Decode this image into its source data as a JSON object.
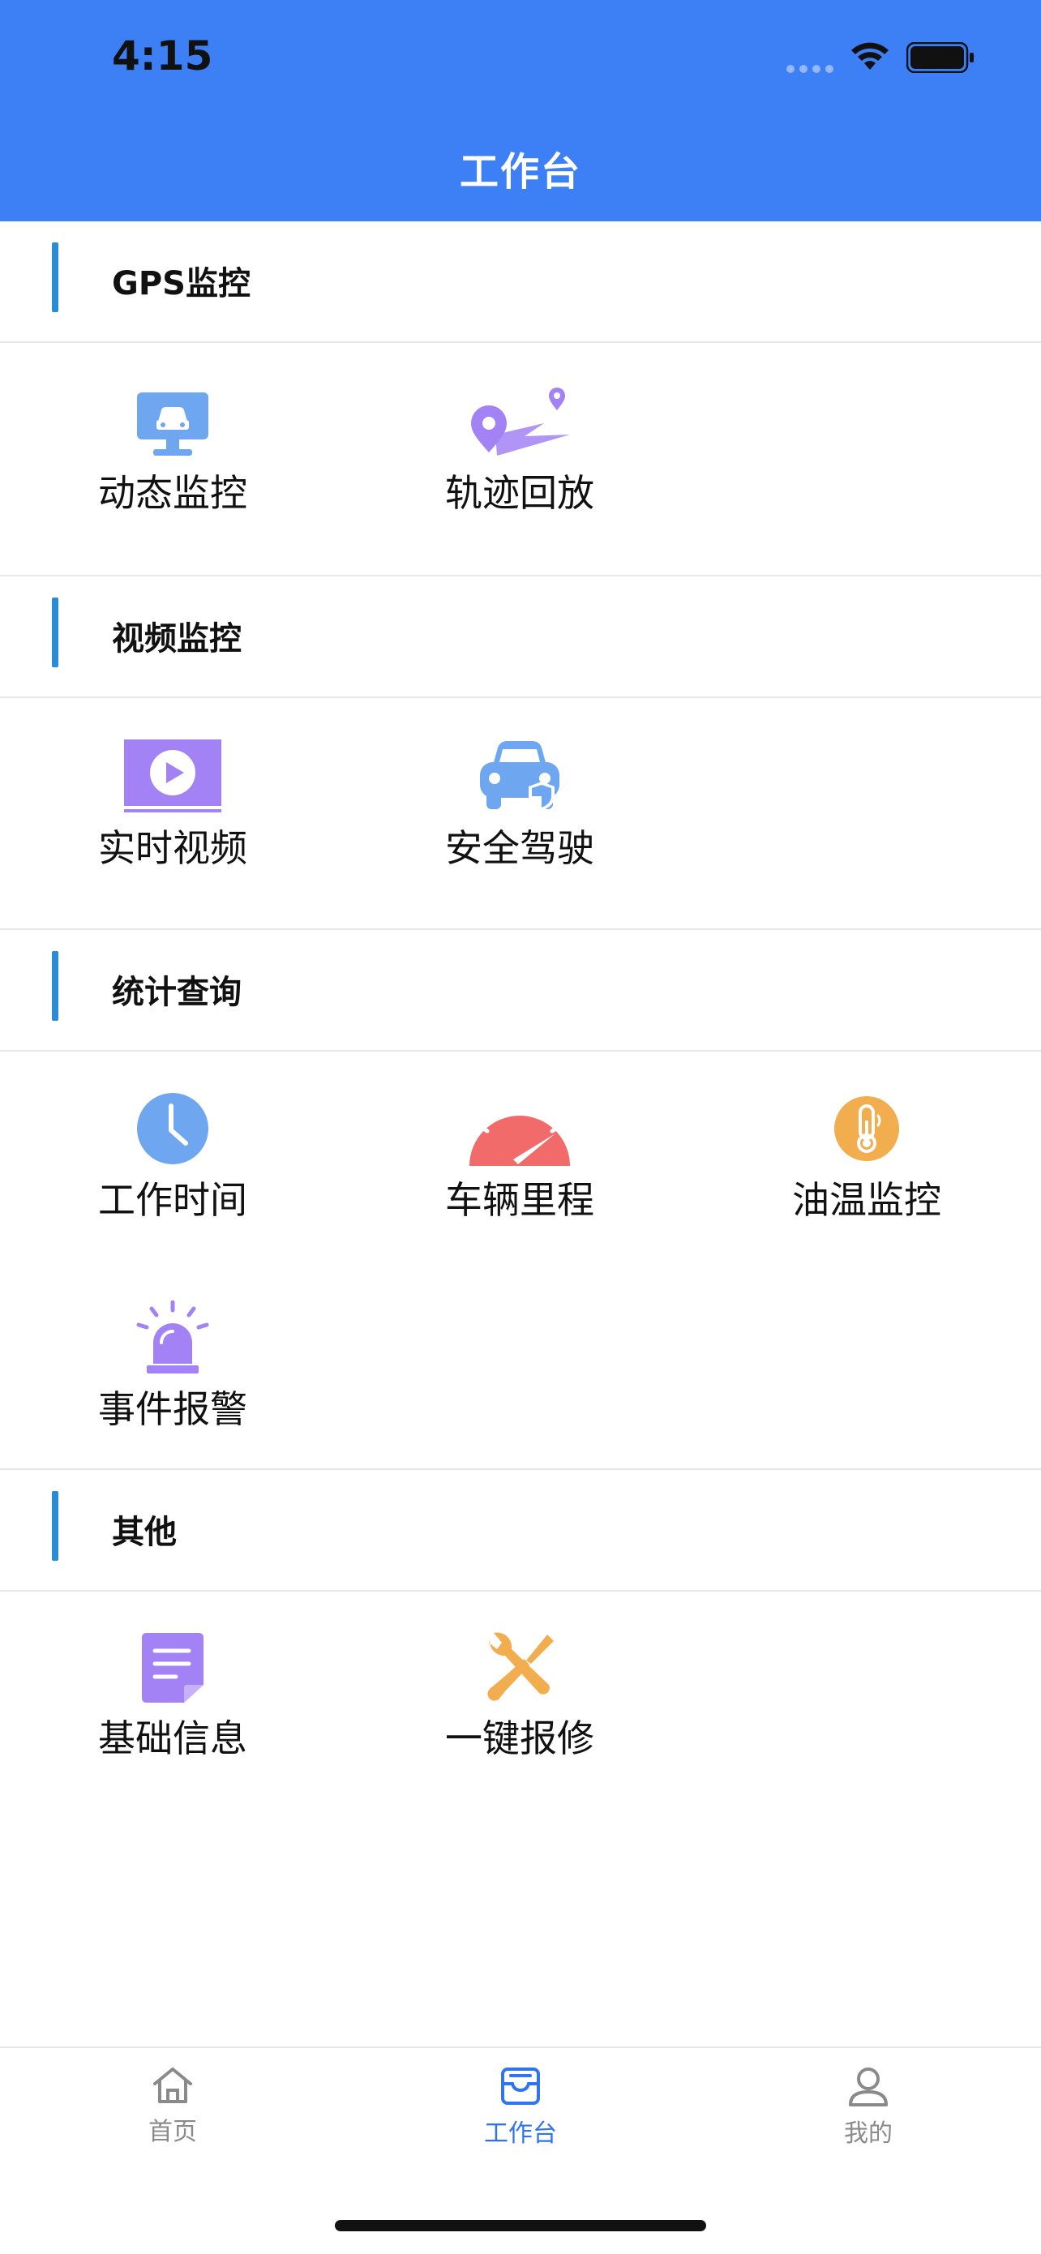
{
  "status_bar": {
    "time": "4:15"
  },
  "header": {
    "title": "工作台"
  },
  "sections": [
    {
      "title": "GPS监控",
      "items": [
        {
          "label": "动态监控",
          "icon": "monitor-car-icon"
        },
        {
          "label": "轨迹回放",
          "icon": "route-playback-icon"
        }
      ]
    },
    {
      "title": "视频监控",
      "items": [
        {
          "label": "实时视频",
          "icon": "video-play-icon"
        },
        {
          "label": "安全驾驶",
          "icon": "car-shield-icon"
        }
      ]
    },
    {
      "title": "统计查询",
      "items": [
        {
          "label": "工作时间",
          "icon": "clock-icon"
        },
        {
          "label": "车辆里程",
          "icon": "speedometer-icon"
        },
        {
          "label": "油温监控",
          "icon": "thermometer-icon"
        },
        {
          "label": "事件报警",
          "icon": "alarm-siren-icon"
        }
      ]
    },
    {
      "title": "其他",
      "items": [
        {
          "label": "基础信息",
          "icon": "document-icon"
        },
        {
          "label": "一键报修",
          "icon": "repair-tools-icon"
        }
      ]
    }
  ],
  "tabbar": {
    "tabs": [
      {
        "label": "首页",
        "icon": "home-icon"
      },
      {
        "label": "工作台",
        "icon": "workbench-icon"
      },
      {
        "label": "我的",
        "icon": "user-icon"
      }
    ],
    "active": "工作台"
  },
  "colors": {
    "header_bg": "#3d7ff5",
    "accent_bar": "#2a8bd6",
    "icon_blue": "#6fa6f0",
    "icon_purple": "#a382f5",
    "icon_red": "#f26b6b",
    "icon_orange": "#f2ad4e",
    "tab_active": "#2f74f0"
  }
}
